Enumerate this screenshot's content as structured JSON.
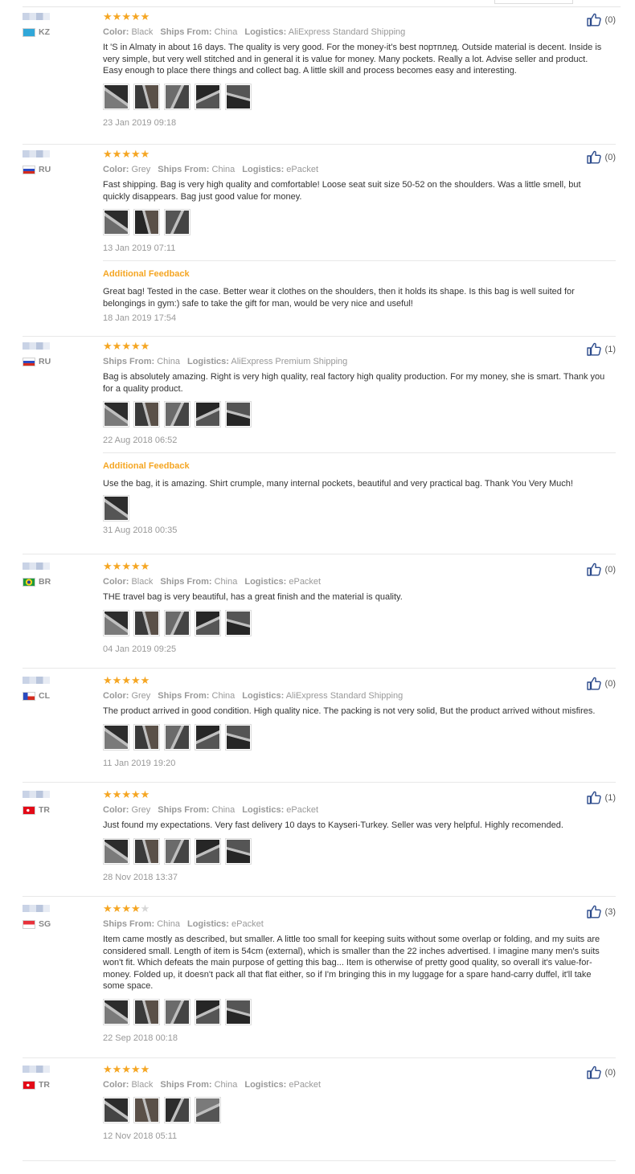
{
  "labels": {
    "color": "Color:",
    "ships_from": "Ships From:",
    "logistics": "Logistics:",
    "additional_feedback": "Additional Feedback"
  },
  "reviews": [
    {
      "country": "KZ",
      "stars": 5,
      "color": "Black",
      "ships_from": "China",
      "logistics": "AliExpress Standard Shipping",
      "text": "It 'S in Almaty in about 16 days. The quality is very good. For the money-it's best портплед. Outside material is decent. Inside is very simple, but very well stitched and in general it is value for money. Many pockets. Really a lot. Advise seller and product. Easy enough to place there things and collect bag. A little skill and process becomes easy and interesting.",
      "photos": 5,
      "date": "23 Jan 2019 09:18",
      "helpful": "(0)"
    },
    {
      "country": "RU",
      "stars": 5,
      "color": "Grey",
      "ships_from": "China",
      "logistics": "ePacket",
      "text": "Fast shipping. Bag is very high quality and comfortable! Loose seat suit size 50-52 on the shoulders. Was a little smell, but quickly disappears. Bag just good value for money.",
      "photos": 3,
      "date": "13 Jan 2019 07:11",
      "helpful": "(0)",
      "additional": {
        "text": "Great bag! Tested in the case. Better wear it clothes on the shoulders, then it holds its shape. Is this bag is well suited for belongings in gym:) safe to take the gift for man, would be very nice and useful!",
        "photos": 0,
        "date": "18 Jan 2019 17:54"
      }
    },
    {
      "country": "RU",
      "stars": 5,
      "ships_from": "China",
      "logistics": "AliExpress Premium Shipping",
      "text": "Bag is absolutely amazing. Right is very high quality, real factory high quality production. For my money, she is smart. Thank you for a quality product.",
      "photos": 5,
      "date": "22 Aug 2018 06:52",
      "helpful": "(1)",
      "additional": {
        "text": "Use the bag, it is amazing. Shirt crumple, many internal pockets, beautiful and very practical bag. Thank You Very Much!",
        "photos": 1,
        "date": "31 Aug 2018 00:35"
      }
    },
    {
      "country": "BR",
      "stars": 5,
      "color": "Black",
      "ships_from": "China",
      "logistics": "ePacket",
      "text": "THE travel bag is very beautiful, has a great finish and the material is quality.",
      "photos": 5,
      "date": "04 Jan 2019 09:25",
      "helpful": "(0)"
    },
    {
      "country": "CL",
      "stars": 5,
      "color": "Grey",
      "ships_from": "China",
      "logistics": "AliExpress Standard Shipping",
      "text": "The product arrived in good condition. High quality nice. The packing is not very solid, But the product arrived without misfires.",
      "photos": 5,
      "date": "11 Jan 2019 19:20",
      "helpful": "(0)"
    },
    {
      "country": "TR",
      "stars": 5,
      "color": "Grey",
      "ships_from": "China",
      "logistics": "ePacket",
      "text": "Just found my expectations. Very fast delivery 10 days to Kayseri-Turkey. Seller was very helpful. Highly recomended.",
      "photos": 5,
      "date": "28 Nov 2018 13:37",
      "helpful": "(1)"
    },
    {
      "country": "SG",
      "stars": 4,
      "ships_from": "China",
      "logistics": "ePacket",
      "text": "Item came mostly as described, but smaller. A little too small for keeping suits without some overlap or folding, and my suits are considered small. Length of item is 54cm (external), which is smaller than the 22 inches advertised. I imagine many men's suits won't fit. Which defeats the main purpose of getting this bag... Item is otherwise of pretty good quality, so overall it's value-for-money. Folded up, it doesn't pack all that flat either, so if I'm bringing this in my luggage for a spare hand-carry duffel, it'll take some space.",
      "photos": 5,
      "date": "22 Sep 2018 00:18",
      "helpful": "(3)"
    },
    {
      "country": "TR",
      "stars": 5,
      "color": "Black",
      "ships_from": "China",
      "logistics": "ePacket",
      "text": "",
      "photos": 4,
      "date": "12 Nov 2018 05:11",
      "helpful": "(0)"
    }
  ]
}
